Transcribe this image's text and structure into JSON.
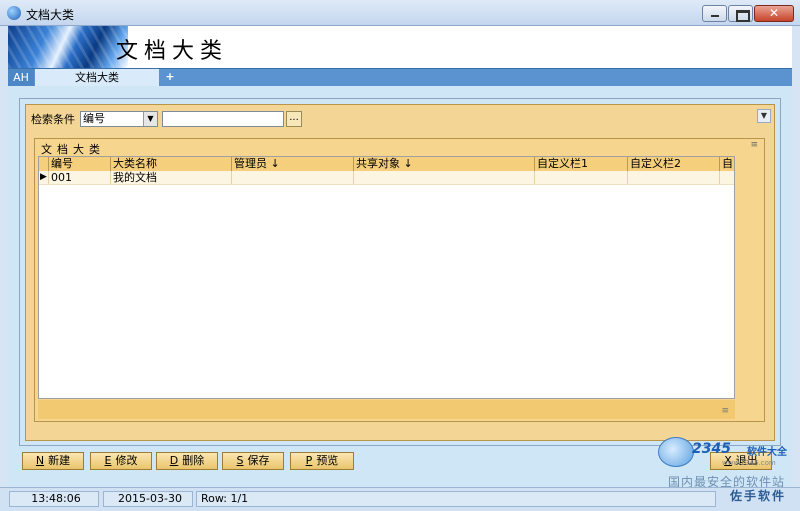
{
  "window": {
    "title": "文档大类"
  },
  "banner": {
    "title": "文档大类"
  },
  "tabs": {
    "user_tab": "AH",
    "active_tab": "文档大类",
    "add_tab": "+"
  },
  "search": {
    "label": "检索条件",
    "field_selected": "编号",
    "input_value": "",
    "browse_label": "..."
  },
  "grid": {
    "title": "文档大类",
    "columns": [
      "编号",
      "大类名称",
      "管理员",
      "共享对象",
      "自定义栏1",
      "自定义栏2",
      "自"
    ],
    "sortable_marks": [
      "",
      "",
      "↓",
      "↓",
      "",
      "",
      ""
    ],
    "rows": [
      {
        "marker": "▶",
        "cells": [
          "001",
          "我的文档",
          "",
          "",
          "",
          "",
          ""
        ]
      }
    ]
  },
  "buttons": {
    "new": {
      "key": "N",
      "label": "新建"
    },
    "edit": {
      "key": "E",
      "label": "修改"
    },
    "delete": {
      "key": "D",
      "label": "删除"
    },
    "save": {
      "key": "S",
      "label": "保存"
    },
    "preview": {
      "key": "P",
      "label": "预览"
    },
    "exit": {
      "key": "X",
      "label": "退出"
    }
  },
  "watermark": {
    "number": "2345",
    "site": "软件大全",
    "url": "www.2345.com",
    "text": "国内最安全的软件站"
  },
  "brand": "佐手软件",
  "status": {
    "time": "13:48:06",
    "date": "2015-03-30",
    "row": "Row: 1/1"
  }
}
